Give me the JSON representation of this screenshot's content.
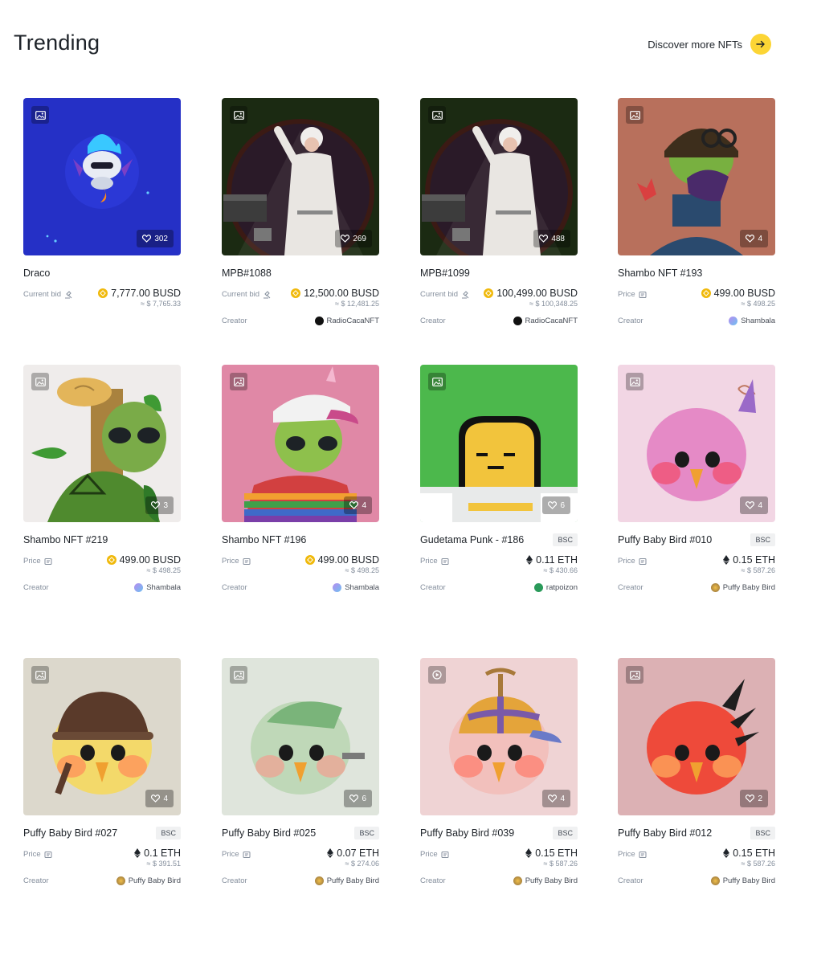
{
  "header": {
    "title": "Trending",
    "discover_label": "Discover more NFTs"
  },
  "icons": {
    "media_badge": "image-icon",
    "video_badge": "play-icon",
    "likes": "heart-icon",
    "discover": "arrow-right-icon",
    "current_bid": "auction-icon",
    "price": "tag-icon"
  },
  "colors": {
    "accent": "#fcd535",
    "busd": "#f0b90b",
    "muted": "#848e9c"
  },
  "cards": [
    {
      "name": "Draco",
      "chain": "",
      "likes": "302",
      "price_label": "Current bid",
      "price": "7,777.00 BUSD",
      "usd": "≈ $ 7,765.33",
      "creator_label": "",
      "creator": "",
      "bg": "#2530c6",
      "art": "draco"
    },
    {
      "name": "MPB#1088",
      "chain": "",
      "likes": "269",
      "price_label": "Current bid",
      "price": "12,500.00 BUSD",
      "usd": "≈ $ 12,481.25",
      "creator_label": "Creator",
      "creator": "RadioCacaNFT",
      "bg": "#1b2a12",
      "art": "mpb"
    },
    {
      "name": "MPB#1099",
      "chain": "",
      "likes": "488",
      "price_label": "Current bid",
      "price": "100,499.00 BUSD",
      "usd": "≈ $ 100,348.25",
      "creator_label": "Creator",
      "creator": "RadioCacaNFT",
      "bg": "#1b2a12",
      "art": "mpb"
    },
    {
      "name": "Shambo NFT #193",
      "chain": "",
      "likes": "4",
      "price_label": "Price",
      "price": "499.00 BUSD",
      "usd": "≈ $ 498.25",
      "creator_label": "Creator",
      "creator": "Shambala",
      "bg": "#b8705c",
      "art": "alien-helmet"
    },
    {
      "name": "Shambo NFT #219",
      "chain": "",
      "likes": "3",
      "price_label": "Price",
      "price": "499.00 BUSD",
      "usd": "≈ $ 498.25",
      "creator_label": "Creator",
      "creator": "Shambala",
      "bg": "#efeceb",
      "art": "alien-tree"
    },
    {
      "name": "Shambo NFT #196",
      "chain": "",
      "likes": "4",
      "price_label": "Price",
      "price": "499.00 BUSD",
      "usd": "≈ $ 498.25",
      "creator_label": "Creator",
      "creator": "Shambala",
      "bg": "#e088a6",
      "art": "alien-cap"
    },
    {
      "name": "Gudetama Punk - #186",
      "chain": "BSC",
      "likes": "6",
      "price_label": "Price",
      "price": "0.11 ETH",
      "usd": "≈ $ 430.66",
      "creator_label": "Creator",
      "creator": "ratpoizon",
      "bg": "#4cb84c",
      "art": "gudetama"
    },
    {
      "name": "Puffy Baby Bird #010",
      "chain": "BSC",
      "likes": "4",
      "price_label": "Price",
      "price": "0.15 ETH",
      "usd": "≈ $ 587.26",
      "creator_label": "Creator",
      "creator": "Puffy Baby Bird",
      "bg": "#f2d6e4",
      "art": "bird-pink"
    },
    {
      "name": "Puffy Baby Bird #027",
      "chain": "BSC",
      "likes": "4",
      "price_label": "Price",
      "price": "0.1 ETH",
      "usd": "≈ $ 391.51",
      "creator_label": "Creator",
      "creator": "Puffy Baby Bird",
      "bg": "#dcd8cc",
      "art": "bird-helmet"
    },
    {
      "name": "Puffy Baby Bird #025",
      "chain": "BSC",
      "likes": "6",
      "price_label": "Price",
      "price": "0.07 ETH",
      "usd": "≈ $ 274.06",
      "creator_label": "Creator",
      "creator": "Puffy Baby Bird",
      "bg": "#dfe5dc",
      "art": "bird-green"
    },
    {
      "name": "Puffy Baby Bird #039",
      "chain": "BSC",
      "likes": "4",
      "price_label": "Price",
      "price": "0.15 ETH",
      "usd": "≈ $ 587.26",
      "creator_label": "Creator",
      "creator": "Puffy Baby Bird",
      "bg": "#efd3d4",
      "art": "bird-cap"
    },
    {
      "name": "Puffy Baby Bird #012",
      "chain": "BSC",
      "likes": "2",
      "price_label": "Price",
      "price": "0.15 ETH",
      "usd": "≈ $ 587.26",
      "creator_label": "Creator",
      "creator": "Puffy Baby Bird",
      "bg": "#dcb1b4",
      "art": "bird-red"
    }
  ]
}
